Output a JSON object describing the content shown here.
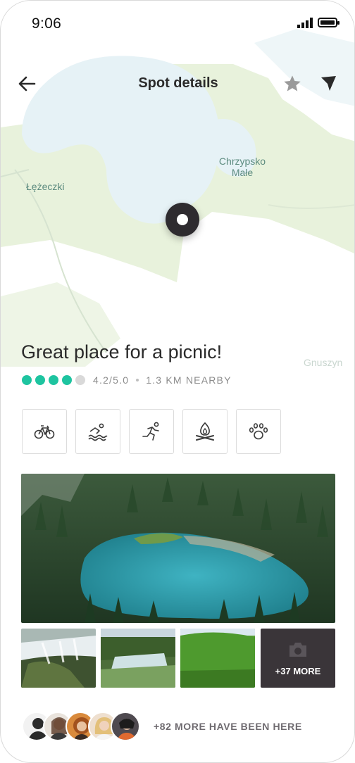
{
  "status_bar": {
    "time": "9:06"
  },
  "header": {
    "title": "Spot details"
  },
  "map": {
    "labels": {
      "left_village": "Łężeczki",
      "right_village_line1": "Chrzypsko",
      "right_village_line2": "Małe",
      "bottom_right": "Gnuszyn"
    }
  },
  "spot": {
    "headline": "Great place for a picnic!",
    "rating": {
      "filled": 4,
      "total": 5,
      "text": "4.2/5.0"
    },
    "distance": "1.3 KM NEARBY",
    "amenities": [
      "bike-icon",
      "swim-icon",
      "run-icon",
      "campfire-icon",
      "paw-icon"
    ]
  },
  "gallery": {
    "more_label": "+37 MORE"
  },
  "visitors": {
    "text": "+82 MORE HAVE BEEN HERE"
  },
  "colors": {
    "accent": "#1ec4a0",
    "rating_empty": "#d9d9d9",
    "pin": "#2e2b2f",
    "more_tile": "#3a3539",
    "lake": "#eef6f8",
    "land": "#e8f2dc"
  }
}
